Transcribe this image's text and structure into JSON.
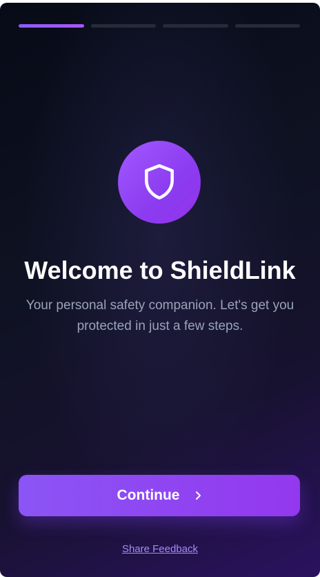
{
  "onboarding": {
    "progress": {
      "total_steps": 4,
      "current_step": 1
    },
    "hero_icon": "shield-icon",
    "title": "Welcome to ShieldLink",
    "subtitle": "Your personal safety companion. Let's get you protected in just a few steps.",
    "continue_button": {
      "label": "Continue",
      "icon": "chevron-right-icon"
    },
    "feedback_link": "Share Feedback"
  },
  "colors": {
    "accent": "#8b5cf6",
    "accent_dark": "#9333ea",
    "background_dark": "#0e1222",
    "subtitle_text": "#9aa3b8",
    "link": "#a78bfa",
    "inactive_segment": "#262b3a"
  }
}
